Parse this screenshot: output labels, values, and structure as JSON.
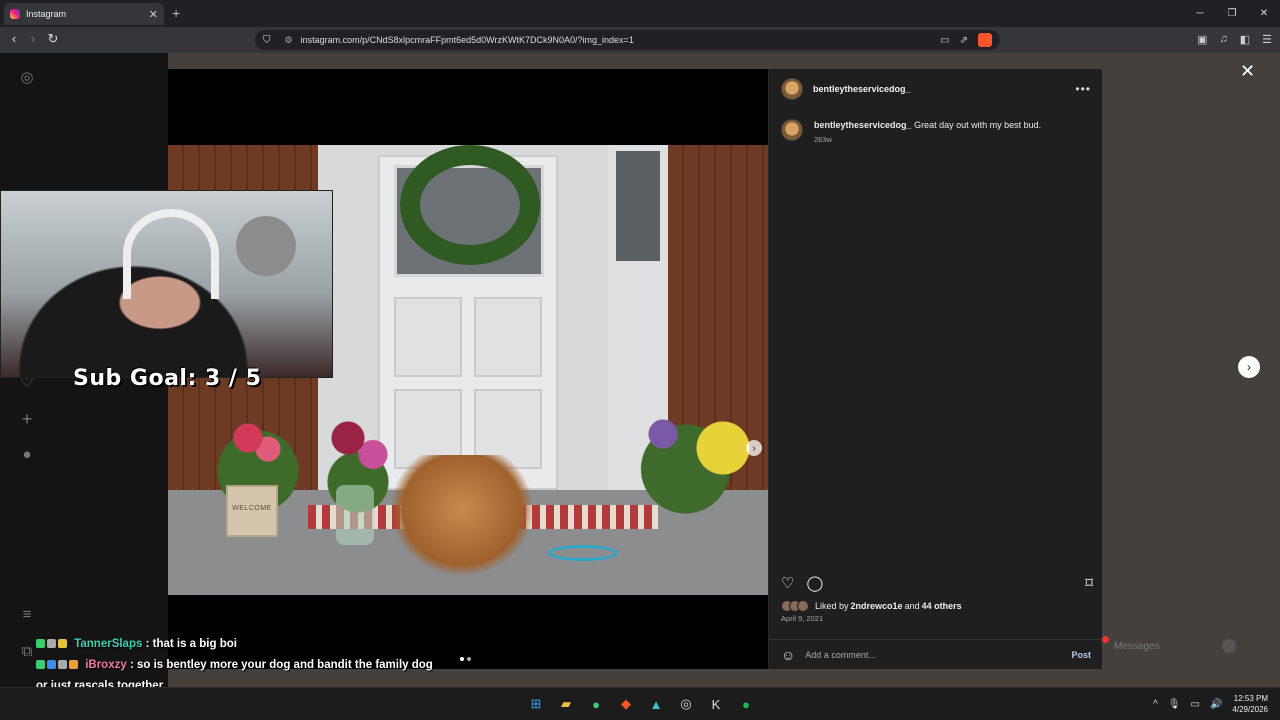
{
  "browser": {
    "tab_title": "Instagram",
    "tab_close": "✕",
    "new_tab": "+",
    "url": "instagram.com/p/CNdS8xlpcmraFFpmt6ed5d0WrzKWtK7DCk9N0A0/?img_index=1",
    "window_controls": {
      "minimize": "─",
      "restore": "❐",
      "close": "✕"
    }
  },
  "post": {
    "username": "bentleytheservicedog_",
    "caption_user": "bentleytheservicedog_",
    "caption_text": "Great day out with my best bud.",
    "age": "263w",
    "liked_by_prefix": "Liked by ",
    "liked_by_user": "2ndrewco1e",
    "liked_by_mid": " and ",
    "liked_by_others": "44 others",
    "date": "April 9, 2021",
    "comment_placeholder": "Add a comment...",
    "post_label": "Post",
    "planter_text": "WELCOME"
  },
  "side": {
    "messages_label": "Messages"
  },
  "stream": {
    "sub_goal": "Sub Goal:  3 / 5",
    "chat": [
      {
        "user": "TannerSlaps",
        "sep": " : ",
        "msg": "that is a big boi"
      },
      {
        "user": "iBroxzy",
        "sep": " : ",
        "msg": "so is bentley more your dog and bandit the family dog or just rascals together"
      }
    ]
  },
  "taskbar": {
    "time": "12:53 PM",
    "date": "4/29/2026"
  },
  "colors": {
    "instagram_bg": "#1f1f1f",
    "accent_post": "#b8c5f0",
    "chat_user1": "#3ad0b2",
    "chat_user2": "#f07aa6"
  }
}
